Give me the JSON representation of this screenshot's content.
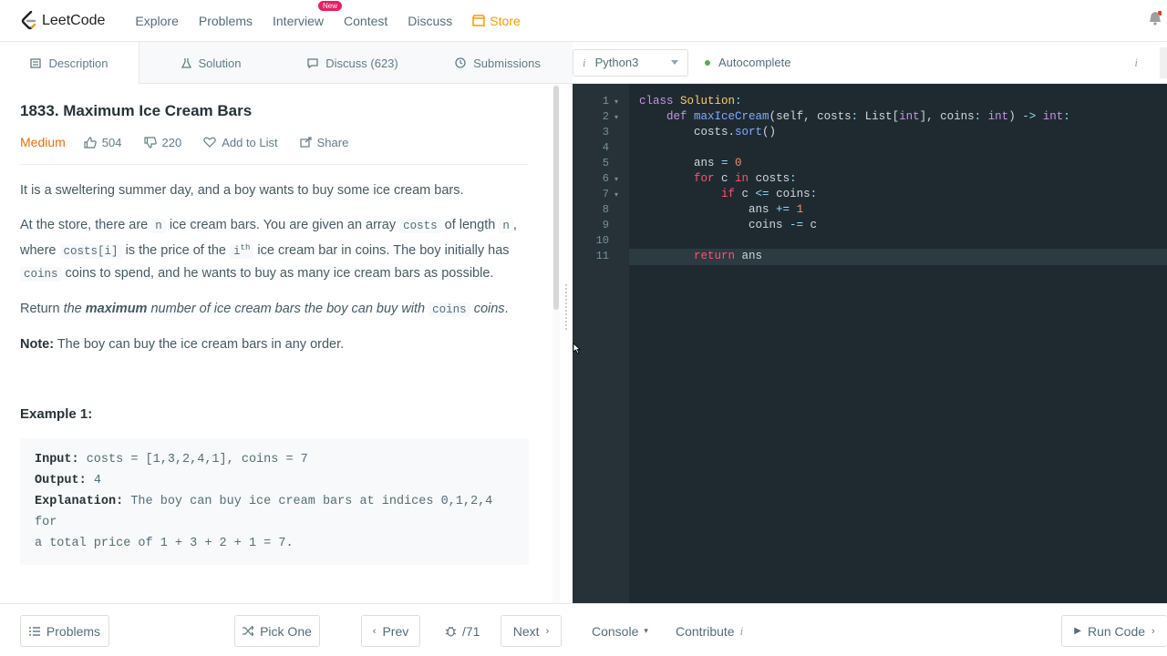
{
  "nav": {
    "logo": "LeetCode",
    "links": [
      "Explore",
      "Problems",
      "Interview",
      "Contest",
      "Discuss"
    ],
    "new_badge": "New",
    "store": "Store"
  },
  "tabs": [
    {
      "label": "Description",
      "icon": "document-icon"
    },
    {
      "label": "Solution",
      "icon": "flask-icon"
    },
    {
      "label": "Discuss (623)",
      "icon": "chat-icon"
    },
    {
      "label": "Submissions",
      "icon": "clock-icon"
    }
  ],
  "editor_bar": {
    "language": "Python3",
    "autocomplete": "Autocomplete",
    "info_mark": "i"
  },
  "problem": {
    "title": "1833. Maximum Ice Cream Bars",
    "difficulty": "Medium",
    "likes": "504",
    "dislikes": "220",
    "add_to_list": "Add to List",
    "share": "Share",
    "p1": "It is a sweltering summer day, and a boy wants to buy some ice cream bars.",
    "p2": {
      "t1": "At the store, there are ",
      "c1": "n",
      "t2": " ice cream bars. You are given an array ",
      "c2": "costs",
      "t3": " of length ",
      "c3": "n",
      "t4": ", where ",
      "c4": "costs[i]",
      "t5": " is the price of the ",
      "c5": "i",
      "sup": "th",
      "t6": " ice cream bar in coins. The boy initially has ",
      "c6": "coins",
      "t7": " coins to spend, and he wants to buy as many ice cream bars as possible."
    },
    "p3": {
      "t1": "Return ",
      "i1": "the ",
      "b1": "maximum",
      "i2": " number of ice cream bars the boy can buy with ",
      "c1": "coins",
      "i3": "coins",
      "t2": "."
    },
    "note_label": "Note:",
    "note_text": " The boy can buy the ice cream bars in any order.",
    "example_title": "Example 1:",
    "example": {
      "input_label": "Input:",
      "input": " costs = [1,3,2,4,1], coins = 7",
      "output_label": "Output:",
      "output": " 4",
      "explanation_label": "Explanation:",
      "explanation_1": " The boy can buy ice cream bars at indices 0,1,2,4 for",
      "explanation_2": "a total price of 1 + 3 + 2 + 1 = 7."
    }
  },
  "code": {
    "line_numbers": [
      "1",
      "2",
      "3",
      "4",
      "5",
      "6",
      "7",
      "8",
      "9",
      "10",
      "11"
    ]
  },
  "bottom": {
    "problems": "Problems",
    "pick_one": "Pick One",
    "prev": "Prev",
    "counter": "/71",
    "next": "Next",
    "console": "Console",
    "contribute": "Contribute",
    "contribute_info": "i",
    "run_code": "Run Code"
  },
  "colors": {
    "accent_orange": "#ef6c00",
    "store_orange": "#ff9800",
    "editor_bg": "#263238",
    "autocomplete_dot": "#4caf50"
  }
}
